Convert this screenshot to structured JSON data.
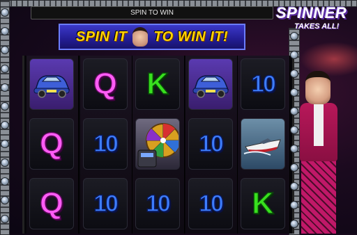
{
  "status": {
    "message": "SPIN TO WIN"
  },
  "banner": {
    "left_text": "SPIN IT",
    "right_text": "TO WIN IT!"
  },
  "logo": {
    "main": "SPINNER",
    "sub": "TAKES ALL!"
  },
  "reels": [
    [
      "car",
      "Q",
      "Q"
    ],
    [
      "Q",
      "10",
      "10"
    ],
    [
      "K",
      "wheel",
      "10"
    ],
    [
      "car",
      "10",
      "10"
    ],
    [
      "10",
      "boat",
      "K"
    ]
  ],
  "symbol_icons": {
    "car": "car-icon",
    "boat": "speedboat-icon",
    "wheel": "prize-wheel-icon"
  },
  "colors": {
    "Q": "#ff5cf5",
    "K": "#38e01e",
    "10": "#3d7dff",
    "banner_text": "#ffd400"
  }
}
